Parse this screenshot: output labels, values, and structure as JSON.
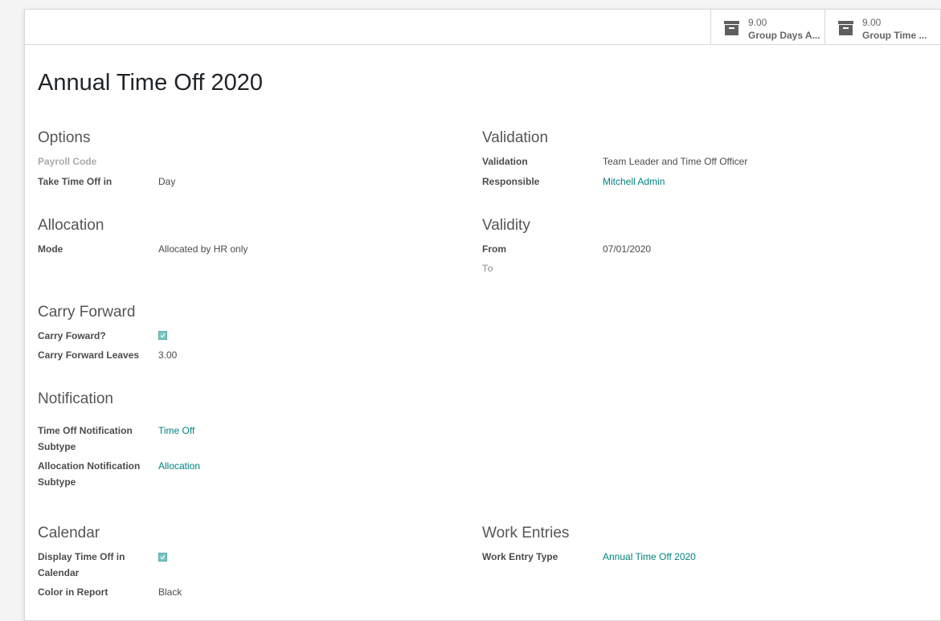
{
  "stat_buttons": [
    {
      "value": "9.00",
      "label": "Group Days A..."
    },
    {
      "value": "9.00",
      "label": "Group Time ..."
    }
  ],
  "record_title": "Annual Time Off 2020",
  "options": {
    "heading": "Options",
    "payroll_code_label": "Payroll Code",
    "take_time_off_label": "Take Time Off in",
    "take_time_off_value": "Day"
  },
  "validation": {
    "heading": "Validation",
    "validation_label": "Validation",
    "validation_value": "Team Leader and Time Off Officer",
    "responsible_label": "Responsible",
    "responsible_value": "Mitchell Admin"
  },
  "allocation": {
    "heading": "Allocation",
    "mode_label": "Mode",
    "mode_value": "Allocated by HR only"
  },
  "validity": {
    "heading": "Validity",
    "from_label": "From",
    "from_value": "07/01/2020",
    "to_label": "To"
  },
  "carry_forward": {
    "heading": "Carry Forward",
    "carry_label": "Carry Foward?",
    "carry_checked": true,
    "leaves_label": "Carry Forward Leaves",
    "leaves_value": "3.00"
  },
  "notification": {
    "heading": "Notification",
    "time_off_label_1": "Time Off Notification",
    "time_off_label_2": "Subtype",
    "time_off_value": "Time Off",
    "allocation_label_1": "Allocation Notification",
    "allocation_label_2": "Subtype",
    "allocation_value": "Allocation"
  },
  "calendar": {
    "heading": "Calendar",
    "display_label_1": "Display Time Off in",
    "display_label_2": "Calendar",
    "display_checked": true,
    "color_label": "Color in Report",
    "color_value": "Black"
  },
  "work_entries": {
    "heading": "Work Entries",
    "type_label": "Work Entry Type",
    "type_value": "Annual Time Off 2020"
  },
  "colors": {
    "link": "#00837f",
    "checkbox": "#79c7c3"
  },
  "icons": {
    "stat_button": "archive-box-icon",
    "checkbox": "check-icon"
  }
}
